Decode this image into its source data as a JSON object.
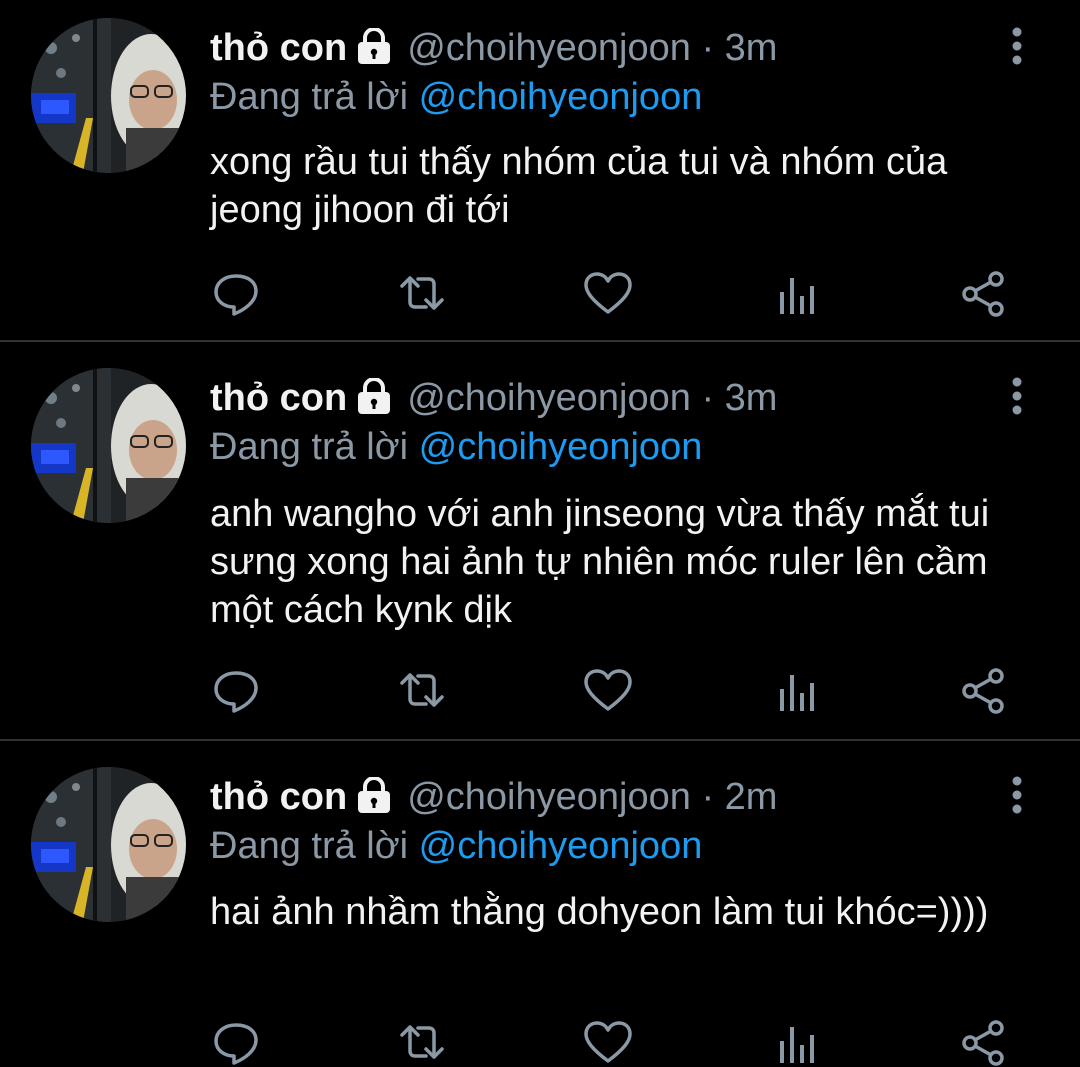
{
  "colors": {
    "background": "#000000",
    "text": "#f2f2f2",
    "muted": "#8b98a5",
    "accent": "#1d9bf0",
    "divider": "#2f3336"
  },
  "icons": {
    "lock": "lock-icon",
    "more": "more-vertical-icon",
    "reply": "reply-icon",
    "retweet": "retweet-icon",
    "like": "heart-icon",
    "analytics": "analytics-icon",
    "share": "share-icon"
  },
  "tweets": [
    {
      "author_name": "thỏ con",
      "handle": "@choihyeonjoon",
      "separator": "·",
      "time": "3m",
      "replying_prefix": "Đang trả lời",
      "replying_to": "@choihyeonjoon",
      "text": "xong rầu tui thấy nhóm của tui và nhóm của jeong jihoon đi tới"
    },
    {
      "author_name": "thỏ con",
      "handle": "@choihyeonjoon",
      "separator": "·",
      "time": "3m",
      "replying_prefix": "Đang trả lời",
      "replying_to": "@choihyeonjoon",
      "text": "anh wangho với anh jinseong vừa thấy mắt tui sưng xong hai ảnh tự nhiên móc ruler lên cầm một cách kynk dịk"
    },
    {
      "author_name": "thỏ con",
      "handle": "@choihyeonjoon",
      "separator": "·",
      "time": "2m",
      "replying_prefix": "Đang trả lời",
      "replying_to": "@choihyeonjoon",
      "text": "hai ảnh nhầm thằng dohyeon làm tui khóc=))))"
    }
  ]
}
